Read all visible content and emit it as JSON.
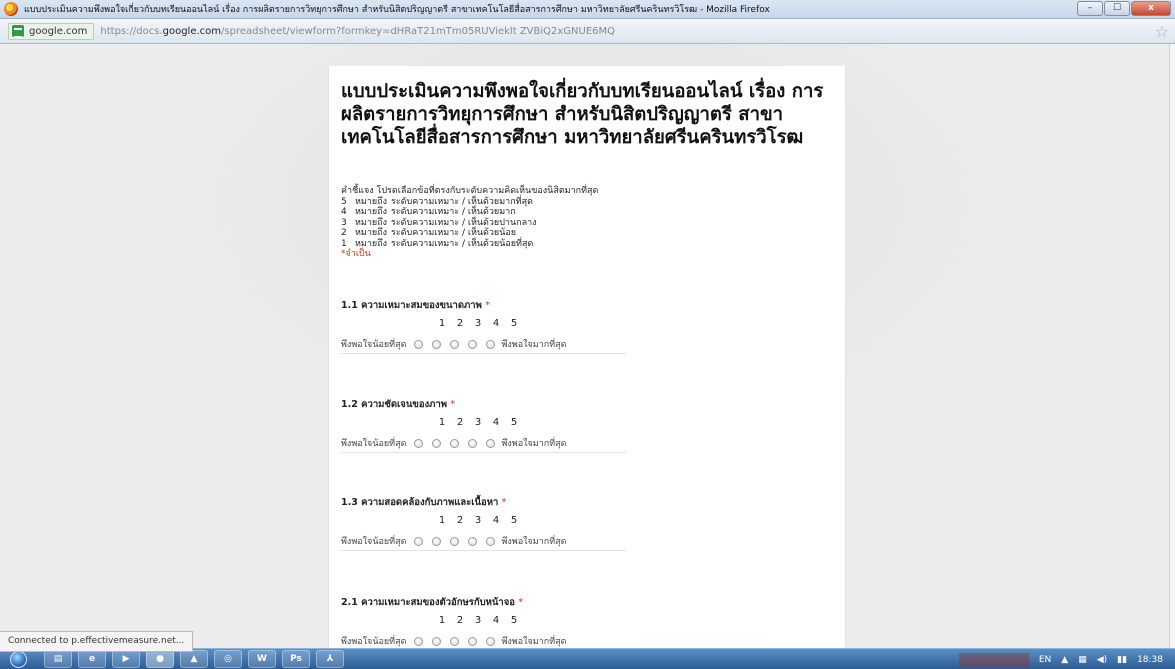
{
  "window": {
    "title": "แบบประเมินความพึงพอใจเกี่ยวกับบทเรียนออนไลน์ เรื่อง การผลิตรายการวิทยุการศึกษา สำหรับนิสิตปริญญาตรี สาขาเทคโนโลยีสื่อสารการศึกษา มหาวิทยาลัยศรีนครินทรวิโรฒ - Mozilla Firefox",
    "min_label": "–",
    "max_label": "☐",
    "close_label": "x"
  },
  "address": {
    "site": "google.com",
    "url_prefix": "https://docs.",
    "url_domain": "google.com",
    "url_path": "/spreadsheet/viewform?formkey=dHRaT21mTm05RUVieklt ZVBiQ2xGNUE6MQ"
  },
  "form": {
    "title": "แบบประเมินความพึงพอใจเกี่ยวกับบทเรียนออนไลน์ เรื่อง การผลิตรายการวิทยุการศึกษา สำหรับนิสิตปริญญาตรี สาขาเทคโนโลยีสื่อสารการศึกษา มหาวิทยาลัยศรีนครินทรวิโรฒ",
    "instruction": "คำชี้แจง  โปรดเลือกข้อที่ตรงกับระดับความคิดเห็นของนิสิตมากที่สุด",
    "legend": [
      {
        "num": "5",
        "mean": "หมายถึง",
        "text": "ระดับความเหมาะ / เห็นด้วยมากที่สุด"
      },
      {
        "num": "4",
        "mean": "หมายถึง",
        "text": "ระดับความเหมาะ / เห็นด้วยมาก"
      },
      {
        "num": "3",
        "mean": "หมายถึง",
        "text": "ระดับความเหมาะ / เห็นด้วยปานกลาง"
      },
      {
        "num": "2",
        "mean": "หมายถึง",
        "text": "ระดับความเหมาะ / เห็นด้วยน้อย"
      },
      {
        "num": "1",
        "mean": "หมายถึง",
        "text": "ระดับความเหมาะ / เห็นด้วยน้อยที่สุด"
      }
    ],
    "required_note": "*จำเป็น",
    "required_star": "*",
    "scale": [
      "1",
      "2",
      "3",
      "4",
      "5"
    ],
    "low_label": "พึงพอใจน้อยที่สุด",
    "high_label": "พึงพอใจมากที่สุด",
    "questions": [
      {
        "title": "1.1 ความเหมาะสมของขนาดภาพ"
      },
      {
        "title": "1.2 ความชัดเจนของภาพ"
      },
      {
        "title": "1.3 ความสอดคล้องกับภาพและเนื้อหา"
      },
      {
        "title": "2.1 ความเหมาะสมของตัวอักษรกับหน้าจอ"
      }
    ]
  },
  "status": {
    "text": "Connected to p.effectivemeasure.net..."
  },
  "taskbar": {
    "lang": "EN",
    "time": "18:38"
  }
}
